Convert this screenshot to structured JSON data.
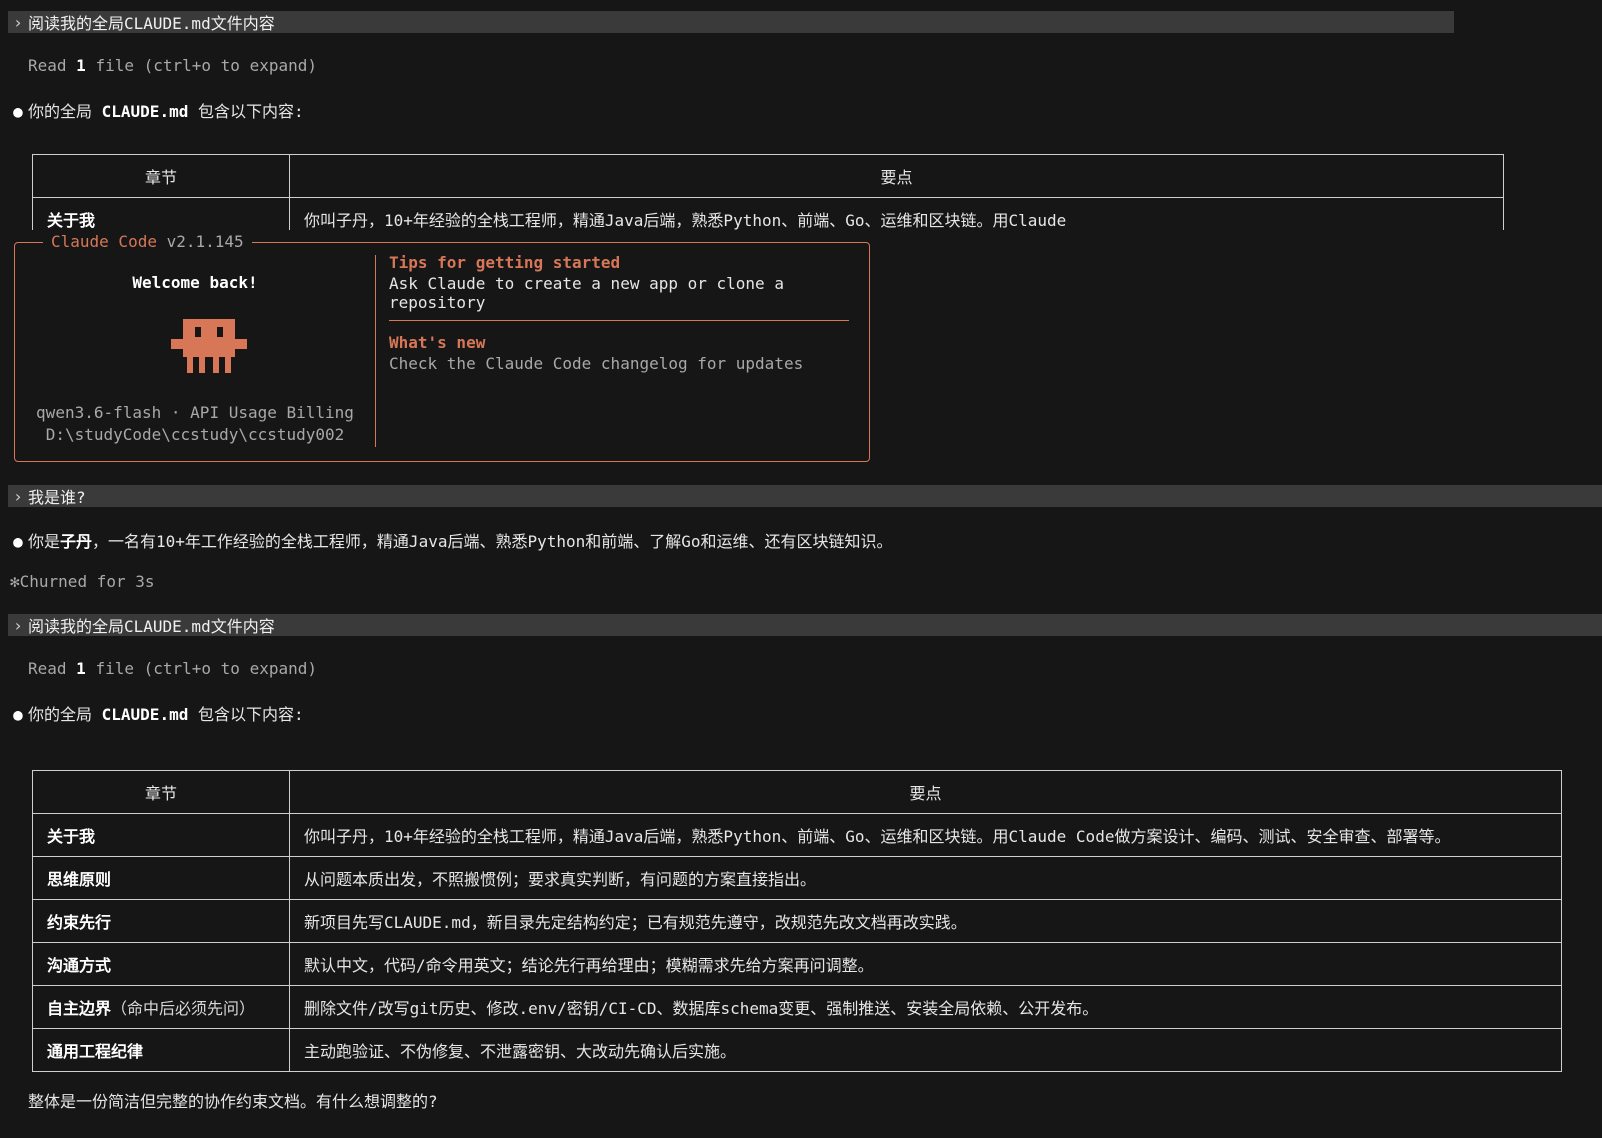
{
  "block1": {
    "prompt": "阅读我的全局CLAUDE.md文件内容",
    "read_prefix": "Read ",
    "read_count": "1",
    "read_suffix": " file (ctrl+o to expand)",
    "reply_prefix": "你的全局 ",
    "reply_file": "CLAUDE.md",
    "reply_suffix": " 包含以下内容:",
    "table_header": [
      "章节",
      "要点"
    ],
    "partial_row": [
      "关于我",
      "你叫子丹，10+年经验的全栈工程师，精通Java后端，熟悉Python、前端、Go、运维和区块链。用Claude"
    ]
  },
  "welcome": {
    "app_name": "Claude Code",
    "version": "v2.1.145",
    "greeting": "Welcome back!",
    "model_line": "qwen3.6-flash · API Usage Billing",
    "path_line": "D:\\studyCode\\ccstudy\\ccstudy002",
    "tips_title": "Tips for getting started",
    "tips_text": "Ask Claude to create a new app or clone a repository",
    "news_title": "What's new",
    "news_text": "Check the Claude Code changelog for updates",
    "accent_color": "#d77757"
  },
  "block2": {
    "prompt": "我是谁?",
    "reply_prefix": "你是",
    "reply_name": "子丹",
    "reply_suffix": "，一名有10+年工作经验的全栈工程师，精通Java后端、熟悉Python和前端、了解Go和运维、还有区块链知识。",
    "status_icon": "✻",
    "status_text": "Churned for 3s"
  },
  "block3": {
    "prompt": "阅读我的全局CLAUDE.md文件内容",
    "read_prefix": "Read ",
    "read_count": "1",
    "read_suffix": " file (ctrl+o to expand)",
    "reply_prefix": "你的全局 ",
    "reply_file": "CLAUDE.md",
    "reply_suffix": " 包含以下内容:",
    "table_header": [
      "章节",
      "要点"
    ],
    "rows": [
      {
        "key": "关于我",
        "note": "",
        "value": "你叫子丹，10+年经验的全栈工程师，精通Java后端，熟悉Python、前端、Go、运维和区块链。用Claude Code做方案设计、编码、测试、安全审查、部署等。"
      },
      {
        "key": "思维原则",
        "note": "",
        "value": "从问题本质出发，不照搬惯例；要求真实判断，有问题的方案直接指出。"
      },
      {
        "key": "约束先行",
        "note": "",
        "value": "新项目先写CLAUDE.md，新目录先定结构约定；已有规范先遵守，改规范先改文档再改实践。"
      },
      {
        "key": "沟通方式",
        "note": "",
        "value": "默认中文，代码/命令用英文；结论先行再给理由；模糊需求先给方案再问调整。"
      },
      {
        "key": "自主边界",
        "note": "（命中后必须先问）",
        "value": "删除文件/改写git历史、修改.env/密钥/CI-CD、数据库schema变更、强制推送、安装全局依赖、公开发布。"
      },
      {
        "key": "通用工程纪律",
        "note": "",
        "value": "主动跑验证、不伪修复、不泄露密钥、大改动先确认后实施。"
      }
    ],
    "closing": "整体是一份简洁但完整的协作约束文档。有什么想调整的?"
  }
}
